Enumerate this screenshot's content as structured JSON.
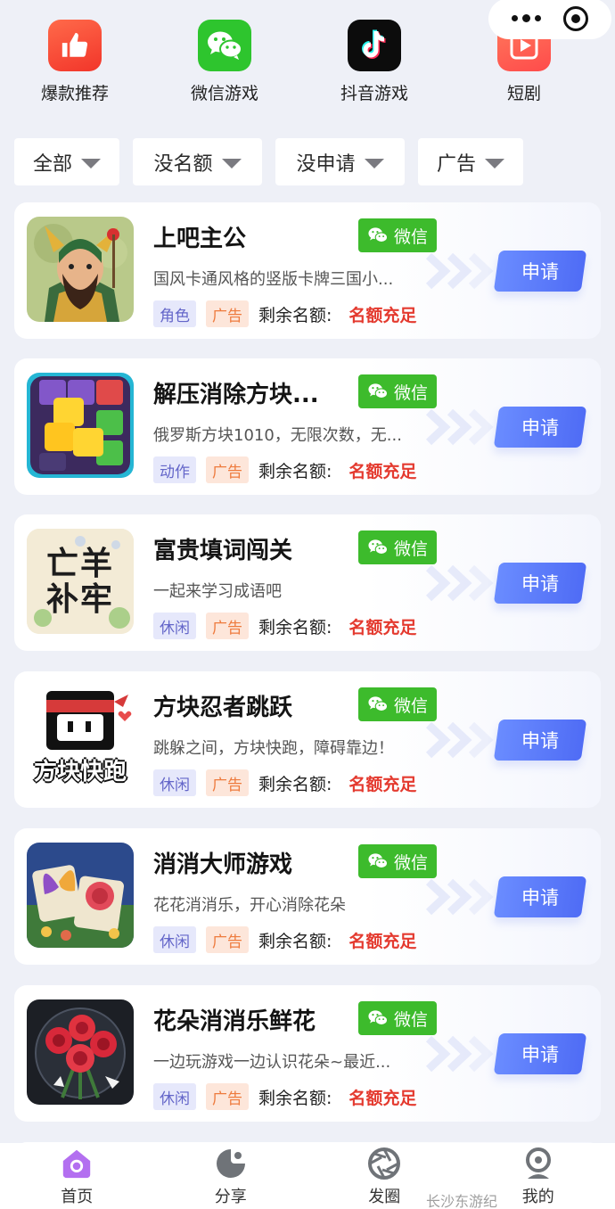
{
  "categories": [
    {
      "label": "爆款推荐",
      "icon": "thumbs-up-icon",
      "color": "#f4443a"
    },
    {
      "label": "微信游戏",
      "icon": "wechat-icon",
      "color": "#2ec52e"
    },
    {
      "label": "抖音游戏",
      "icon": "douyin-icon",
      "color": "#0c0c0c"
    },
    {
      "label": "短剧",
      "icon": "play-icon",
      "color": "#ff5a4e"
    }
  ],
  "filters": [
    {
      "label": "全部"
    },
    {
      "label": "没名额"
    },
    {
      "label": "没申请"
    },
    {
      "label": "广告"
    }
  ],
  "games": [
    {
      "title": "上吧主公",
      "platform": "微信",
      "desc": "国风卡通风格的竖版卡牌三国小...",
      "type_tag": "角色",
      "ad_tag": "广告",
      "quota_label": "剩余名额:",
      "quota_value": "名额充足",
      "button": "申请",
      "thumb": "warrior-thumbnail"
    },
    {
      "title": "解压消除方块...",
      "platform": "微信",
      "desc": "俄罗斯方块1010，无限次数，无...",
      "type_tag": "动作",
      "ad_tag": "广告",
      "quota_label": "剩余名额:",
      "quota_value": "名额充足",
      "button": "申请",
      "thumb": "blocks-thumbnail"
    },
    {
      "title": "富贵填词闯关",
      "platform": "微信",
      "desc": "一起来学习成语吧",
      "type_tag": "休闲",
      "ad_tag": "广告",
      "quota_label": "剩余名额:",
      "quota_value": "名额充足",
      "button": "申请",
      "thumb": "idiom-thumbnail",
      "thumb_text": "亡羊补牢"
    },
    {
      "title": "方块忍者跳跃",
      "platform": "微信",
      "desc": "跳躲之间，方块快跑，障碍靠边！",
      "type_tag": "休闲",
      "ad_tag": "广告",
      "quota_label": "剩余名额:",
      "quota_value": "名额充足",
      "button": "申请",
      "thumb": "ninja-thumbnail",
      "thumb_text": "方块快跑"
    },
    {
      "title": "消消大师游戏",
      "platform": "微信",
      "desc": "花花消消乐，开心消除花朵",
      "type_tag": "休闲",
      "ad_tag": "广告",
      "quota_label": "剩余名额:",
      "quota_value": "名额充足",
      "button": "申请",
      "thumb": "butterfly-rose-thumbnail"
    },
    {
      "title": "花朵消消乐鲜花",
      "platform": "微信",
      "desc": "一边玩游戏一边认识花朵~最近...",
      "type_tag": "休闲",
      "ad_tag": "广告",
      "quota_label": "剩余名额:",
      "quota_value": "名额充足",
      "button": "申请",
      "thumb": "roses-thumbnail"
    }
  ],
  "tabs": [
    {
      "label": "首页",
      "icon": "home-icon",
      "active": true
    },
    {
      "label": "分享",
      "icon": "share-icon",
      "active": false
    },
    {
      "label": "发圈",
      "icon": "aperture-icon",
      "active": false
    },
    {
      "label": "我的",
      "icon": "profile-icon",
      "active": false
    }
  ],
  "watermark": "长沙东游纪",
  "colors": {
    "accent": "#5a78f7",
    "wechat": "#3dbb2c",
    "quota": "#e43a2f",
    "ad_tag": "#ee7b3e",
    "type_tag": "#6466c9"
  }
}
